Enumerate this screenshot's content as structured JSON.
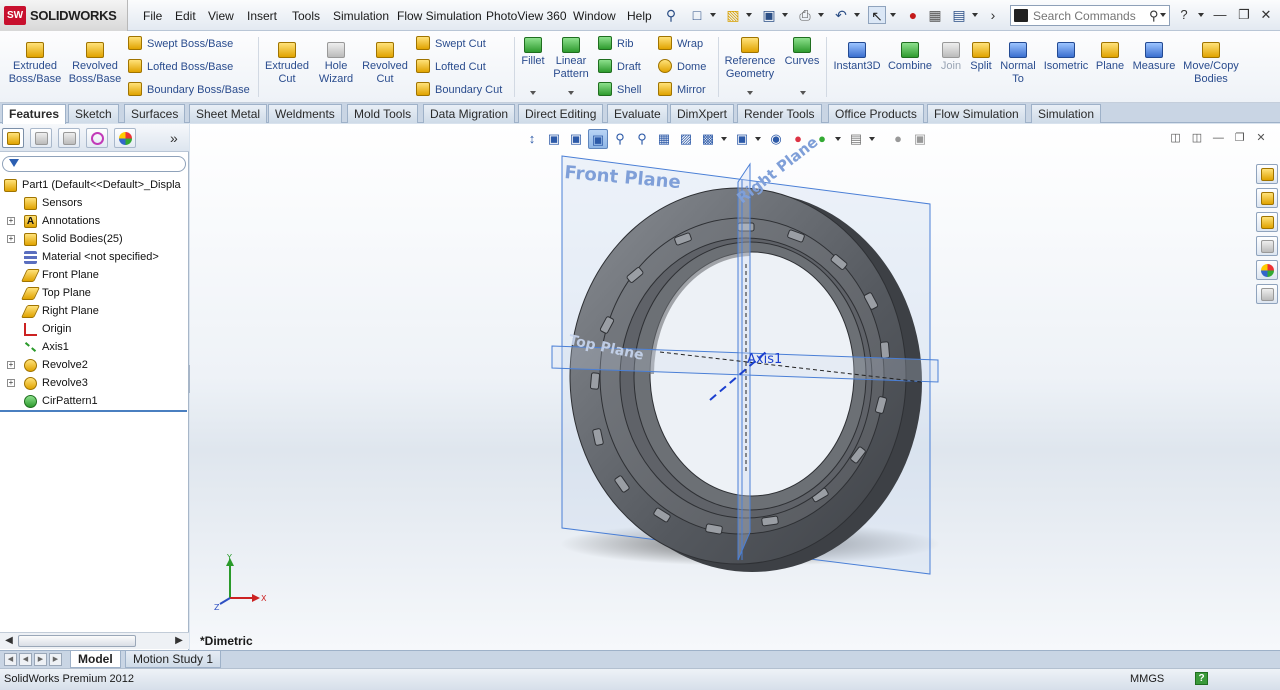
{
  "app": {
    "brand": "SOLIDWORKS",
    "brand_badge": "SW"
  },
  "menu": [
    {
      "label": "File"
    },
    {
      "label": "Edit"
    },
    {
      "label": "View"
    },
    {
      "label": "Insert"
    },
    {
      "label": "Tools"
    },
    {
      "label": "Simulation"
    },
    {
      "label": "Flow Simulation"
    },
    {
      "label": "PhotoView 360"
    },
    {
      "label": "Window"
    },
    {
      "label": "Help"
    }
  ],
  "search": {
    "placeholder": "Search Commands"
  },
  "commands": {
    "extruded_boss": "Extruded Boss/Base",
    "revolved_boss": "Revolved Boss/Base",
    "swept_boss": "Swept Boss/Base",
    "lofted_boss": "Lofted Boss/Base",
    "boundary_boss": "Boundary Boss/Base",
    "extruded_cut": "Extruded Cut",
    "hole_wizard": "Hole Wizard",
    "revolved_cut": "Revolved Cut",
    "swept_cut": "Swept Cut",
    "lofted_cut": "Lofted Cut",
    "boundary_cut": "Boundary Cut",
    "fillet": "Fillet",
    "linear_pattern": "Linear Pattern",
    "rib": "Rib",
    "draft": "Draft",
    "shell": "Shell",
    "wrap": "Wrap",
    "dome": "Dome",
    "mirror": "Mirror",
    "reference_geometry": "Reference Geometry",
    "curves": "Curves",
    "instant3d": "Instant3D",
    "combine": "Combine",
    "join": "Join",
    "split": "Split",
    "normal_to": "Normal To",
    "isometric": "Isometric",
    "plane": "Plane",
    "measure": "Measure",
    "move_copy": "Move/Copy Bodies"
  },
  "tabs": [
    {
      "label": "Features",
      "active": true
    },
    {
      "label": "Sketch"
    },
    {
      "label": "Surfaces"
    },
    {
      "label": "Sheet Metal"
    },
    {
      "label": "Weldments"
    },
    {
      "label": "Mold Tools"
    },
    {
      "label": "Data Migration"
    },
    {
      "label": "Direct Editing"
    },
    {
      "label": "Evaluate"
    },
    {
      "label": "DimXpert"
    },
    {
      "label": "Render Tools"
    },
    {
      "label": "Office Products"
    },
    {
      "label": "Flow Simulation"
    },
    {
      "label": "Simulation"
    }
  ],
  "tree": [
    {
      "label": "Part1  (Default<<Default>_Displa",
      "icon": "part-icon",
      "level": 0
    },
    {
      "label": "Sensors",
      "icon": "sensors-icon",
      "level": 1
    },
    {
      "label": "Annotations",
      "icon": "annotations-icon",
      "level": 1,
      "expandable": true
    },
    {
      "label": "Solid Bodies(25)",
      "icon": "solid-bodies-icon",
      "level": 1,
      "expandable": true
    },
    {
      "label": "Material <not specified>",
      "icon": "material-icon",
      "level": 1
    },
    {
      "label": "Front Plane",
      "icon": "plane-icon",
      "level": 1
    },
    {
      "label": "Top Plane",
      "icon": "plane-icon",
      "level": 1
    },
    {
      "label": "Right Plane",
      "icon": "plane-icon",
      "level": 1
    },
    {
      "label": "Origin",
      "icon": "origin-icon",
      "level": 1
    },
    {
      "label": "Axis1",
      "icon": "axis-icon",
      "level": 1
    },
    {
      "label": "Revolve2",
      "icon": "revolve-icon",
      "level": 1,
      "expandable": true
    },
    {
      "label": "Revolve3",
      "icon": "revolve-icon",
      "level": 1,
      "expandable": true
    },
    {
      "label": "CirPattern1",
      "icon": "circular-pattern-icon",
      "level": 1
    }
  ],
  "viewport": {
    "view_label": "*Dimetric",
    "front_plane_label": "Front Plane",
    "right_plane_label": "Right Plane",
    "top_plane_label": "Top Plane",
    "axis_label": "Axis1",
    "triad": {
      "x": "X",
      "y": "Y",
      "z": "Z"
    }
  },
  "bottom_tabs": [
    {
      "label": "Model",
      "active": true
    },
    {
      "label": "Motion Study 1"
    }
  ],
  "status": {
    "product": "SolidWorks Premium 2012",
    "units": "MMGS",
    "help": "?"
  },
  "colors": {
    "accent": "#2a4c8e",
    "plane": "#4a7fd6",
    "part": "#6f7378"
  }
}
